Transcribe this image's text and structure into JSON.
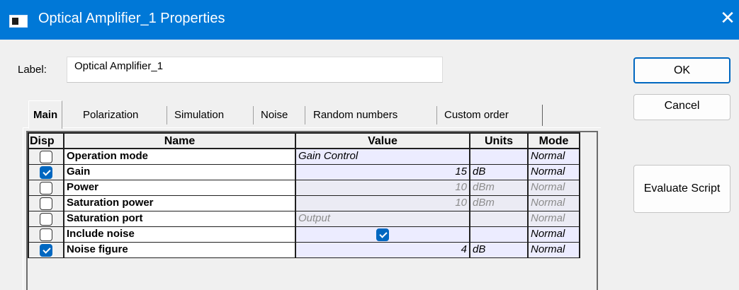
{
  "window": {
    "title": "Optical Amplifier_1 Properties",
    "close_glyph": "✕",
    "icons": [
      "window-app-icon",
      "close-icon"
    ]
  },
  "label": {
    "caption": "Label:",
    "value": "Optical Amplifier_1"
  },
  "buttons": {
    "ok": "OK",
    "cancel": "Cancel",
    "evaluate": "Evaluate Script"
  },
  "tabs": [
    {
      "label": "Main",
      "active": true
    },
    {
      "label": "Polarization"
    },
    {
      "label": "Simulation"
    },
    {
      "label": "Noise"
    },
    {
      "label": "Random numbers"
    },
    {
      "label": "Custom order"
    }
  ],
  "table": {
    "headers": {
      "disp": "Disp",
      "name": "Name",
      "value": "Value",
      "units": "Units",
      "mode": "Mode"
    },
    "rows": [
      {
        "disp": false,
        "name": "Operation mode",
        "value": "Gain Control",
        "units": "",
        "mode": "Normal",
        "style": "editable",
        "value_align": "left"
      },
      {
        "disp": true,
        "name": "Gain",
        "value": "15",
        "units": "dB",
        "mode": "Normal",
        "style": "editable",
        "value_align": "right"
      },
      {
        "disp": false,
        "name": "Power",
        "value": "10",
        "units": "dBm",
        "mode": "Normal",
        "style": "readonly",
        "value_align": "right"
      },
      {
        "disp": false,
        "name": "Saturation power",
        "value": "10",
        "units": "dBm",
        "mode": "Normal",
        "style": "readonly",
        "value_align": "right"
      },
      {
        "disp": false,
        "name": "Saturation port",
        "value": "Output",
        "units": "",
        "mode": "Normal",
        "style": "readonly",
        "value_align": "left"
      },
      {
        "disp": false,
        "name": "Include noise",
        "value_checkbox": true,
        "units": "",
        "mode": "Normal",
        "style": "editable"
      },
      {
        "disp": true,
        "name": "Noise figure",
        "value": "4",
        "units": "dB",
        "mode": "Normal",
        "style": "editable",
        "value_align": "right"
      }
    ]
  },
  "colors": {
    "titlebar": "#0078d7",
    "accent": "#0067c0",
    "editable_cell": "#ececff",
    "readonly_cell": "#ebebf4"
  }
}
